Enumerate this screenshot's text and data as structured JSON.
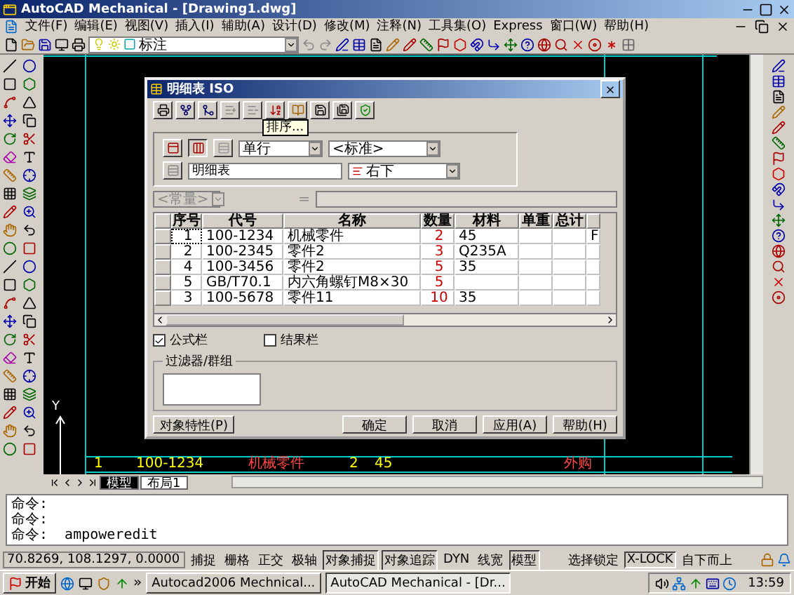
{
  "window": {
    "title": "AutoCAD Mechanical - [Drawing1.dwg]"
  },
  "menu": [
    "文件(F)",
    "编辑(E)",
    "视图(V)",
    "插入(I)",
    "辅助(A)",
    "设计(D)",
    "修改(M)",
    "注释(N)",
    "工具集(O)",
    "Express",
    "窗口(W)",
    "帮助(H)"
  ],
  "layer_dropdown": {
    "value": "标注"
  },
  "canvas": {
    "ucs_label": "Y",
    "title_block_row": [
      "1",
      "100-1234",
      "机械零件",
      "2",
      "45",
      "外购"
    ]
  },
  "dialog": {
    "title": "明细表 ISO",
    "tooltip": "排序...",
    "style_dropdown": {
      "value": "单行"
    },
    "standard_dropdown": {
      "value": "<标准>"
    },
    "name_field": {
      "value": "明细表"
    },
    "direction_dropdown": {
      "value": "右下"
    },
    "constant_dropdown": {
      "value": "<常量>",
      "disabled": true
    },
    "formula_label": "=",
    "table": {
      "columns": [
        "序号",
        "代号",
        "名称",
        "数量",
        "材料",
        "单重",
        "总计"
      ],
      "rows": [
        {
          "selected": true,
          "cells": [
            "1",
            "100-1234",
            "机械零件",
            "2",
            "45"
          ],
          "column_8": "F"
        },
        {
          "selected": false,
          "cells": [
            "2",
            "100-2345",
            "零件2",
            "3",
            "Q235A"
          ]
        },
        {
          "selected": false,
          "cells": [
            "4",
            "100-3456",
            "零件2",
            "5",
            "35"
          ]
        },
        {
          "selected": false,
          "cells": [
            "5",
            "GB/T70.1",
            "内六角螺钉M8×30",
            "5"
          ]
        },
        {
          "selected": false,
          "cells": [
            "3",
            "100-5678",
            "零件11",
            "10",
            "35"
          ]
        }
      ]
    },
    "checkboxes": [
      {
        "label": "公式栏",
        "checked": true
      },
      {
        "label": "结果栏",
        "checked": false
      }
    ],
    "filter_group": {
      "title": "过滤器/群组"
    },
    "properties_button": "对象特性(P)",
    "buttons": [
      "确定",
      "取消",
      "应用(A)",
      "帮助(H)"
    ]
  },
  "layout_tabs": [
    {
      "label": "模型",
      "selected": true
    },
    {
      "label": "布局1",
      "selected": false
    }
  ],
  "command_lines": [
    "命令:",
    "命令:",
    "命令:  ampoweredit"
  ],
  "status_bar": {
    "coordinates": "70.8269,  108.1297,  0.0000",
    "toggles": [
      {
        "label": "捕捉",
        "pressed": false
      },
      {
        "label": "栅格",
        "pressed": false
      },
      {
        "label": "正交",
        "pressed": false
      },
      {
        "label": "极轴",
        "pressed": false
      },
      {
        "label": "对象捕捉",
        "pressed": true
      },
      {
        "label": "对象追踪",
        "pressed": true
      },
      {
        "label": "DYN",
        "pressed": false
      },
      {
        "label": "线宽",
        "pressed": false
      },
      {
        "label": "模型",
        "pressed": true
      }
    ],
    "extra": [
      {
        "label": "选择锁定",
        "pressed": false
      },
      {
        "label": "X-LOCK",
        "pressed": true
      },
      {
        "label": "自下而上",
        "pressed": false
      }
    ]
  },
  "taskbar": {
    "start": "开始",
    "quick_more": "»",
    "tasks": [
      {
        "label": "Autocad2006 Mechnical...",
        "selected": false
      },
      {
        "label": "AutoCAD Mechanical - [Dr...",
        "selected": true
      }
    ],
    "clock": "13:59"
  }
}
